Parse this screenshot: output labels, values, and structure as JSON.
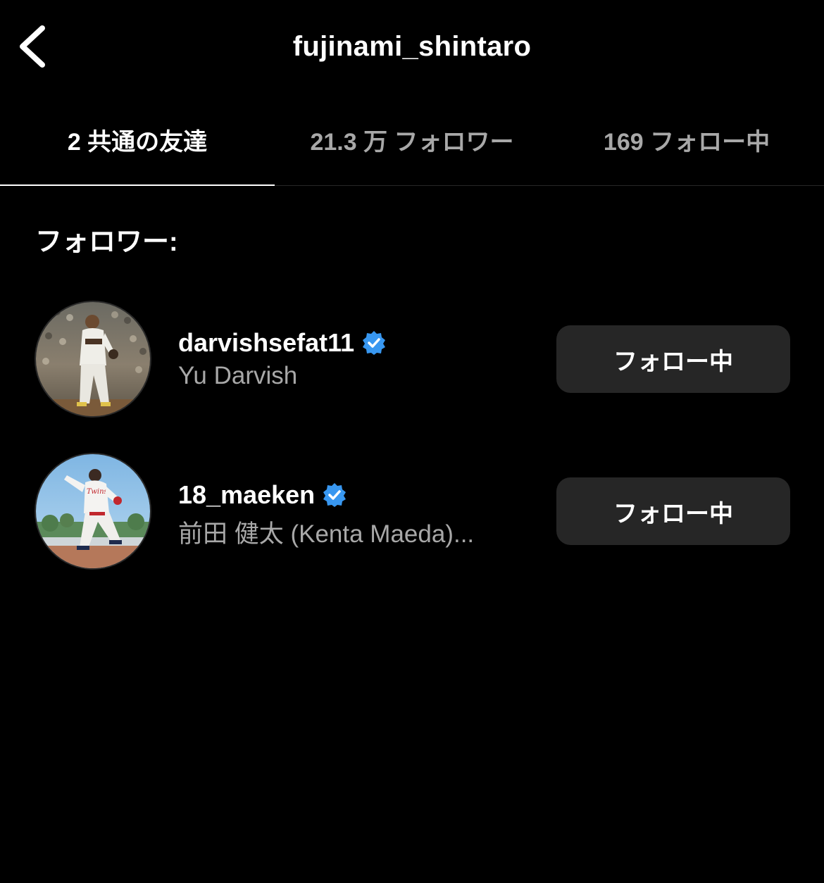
{
  "header": {
    "title": "fujinami_shintaro",
    "back_icon": "chevron-left-icon"
  },
  "tabs": [
    {
      "label": "2 共通の友達",
      "active": true
    },
    {
      "label": "21.3 万 フォロワー",
      "active": false
    },
    {
      "label": "169 フォロー中",
      "active": false
    }
  ],
  "section": {
    "label": "フォロワー:"
  },
  "users": [
    {
      "username": "darvishsefat11",
      "verified": true,
      "full_name": "Yu Darvish",
      "button_label": "フォロー中"
    },
    {
      "username": "18_maeken",
      "verified": true,
      "full_name": "前田 健太 (Kenta Maeda)...",
      "button_label": "フォロー中"
    }
  ],
  "colors": {
    "background": "#000000",
    "text_primary": "#ffffff",
    "text_secondary": "#a8a8a8",
    "button_bg": "#262626",
    "verified_blue": "#3897f0"
  }
}
